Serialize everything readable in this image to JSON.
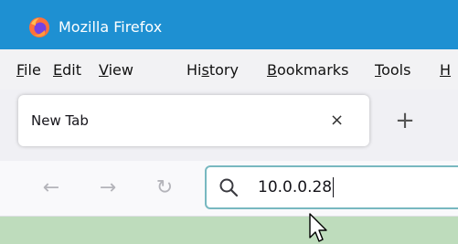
{
  "window": {
    "title": "Mozilla Firefox"
  },
  "menu": {
    "items": [
      {
        "prefix": "",
        "accel": "F",
        "rest": "ile"
      },
      {
        "prefix": "",
        "accel": "E",
        "rest": "dit"
      },
      {
        "prefix": "",
        "accel": "V",
        "rest": "iew"
      },
      {
        "prefix": "Hi",
        "accel": "s",
        "rest": "tory"
      },
      {
        "prefix": "",
        "accel": "B",
        "rest": "ookmarks"
      },
      {
        "prefix": "",
        "accel": "T",
        "rest": "ools"
      },
      {
        "prefix": "",
        "accel": "H",
        "rest": ""
      }
    ]
  },
  "tabs": {
    "active_label": "New Tab",
    "close_glyph": "×",
    "new_tab_glyph": "+"
  },
  "nav": {
    "back_glyph": "←",
    "forward_glyph": "→",
    "reload_glyph": "↻"
  },
  "urlbar": {
    "value": "10.0.0.28"
  },
  "colors": {
    "titlebar": "#1e90d2",
    "urlbar_border": "#78b8c0",
    "content_bg": "#bedcbc"
  },
  "icons": [
    "firefox-logo-icon",
    "close-icon",
    "plus-icon",
    "back-arrow-icon",
    "forward-arrow-icon",
    "reload-icon",
    "search-icon",
    "mouse-pointer-icon"
  ]
}
